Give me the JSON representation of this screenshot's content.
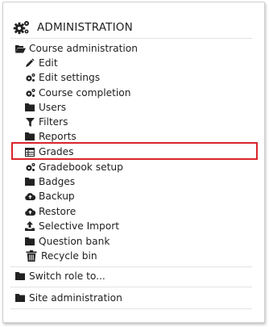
{
  "block": {
    "title": "ADMINISTRATION",
    "title_icon": "cogs-icon"
  },
  "course_admin": {
    "label": "Course administration",
    "icon": "folder-open-icon",
    "items": [
      {
        "label": "Edit",
        "icon": "pencil-icon"
      },
      {
        "label": "Edit settings",
        "icon": "cog-icon"
      },
      {
        "label": "Course completion",
        "icon": "cog-icon"
      },
      {
        "label": "Users",
        "icon": "folder-icon"
      },
      {
        "label": "Filters",
        "icon": "filter-icon"
      },
      {
        "label": "Reports",
        "icon": "folder-icon"
      },
      {
        "label": "Grades",
        "icon": "table-icon"
      },
      {
        "label": "Gradebook setup",
        "icon": "cog-icon"
      },
      {
        "label": "Badges",
        "icon": "folder-icon"
      },
      {
        "label": "Backup",
        "icon": "cloud-upload-icon"
      },
      {
        "label": "Restore",
        "icon": "cloud-upload-icon"
      },
      {
        "label": "Selective Import",
        "icon": "upload-icon"
      },
      {
        "label": "Question bank",
        "icon": "folder-icon"
      },
      {
        "label": "Recycle bin",
        "icon": "trash-icon"
      }
    ]
  },
  "switch_role": {
    "label": "Switch role to...",
    "icon": "folder-icon"
  },
  "site_admin": {
    "label": "Site administration",
    "icon": "folder-icon"
  },
  "colors": {
    "highlight": "#d9262c"
  }
}
